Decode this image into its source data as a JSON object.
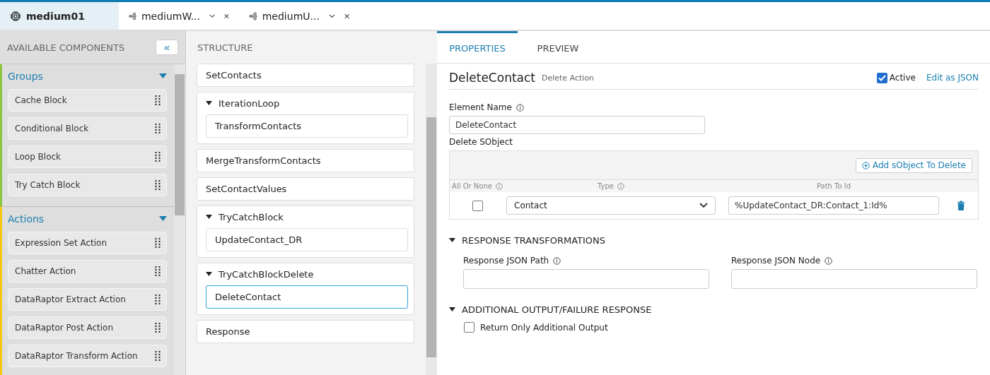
{
  "tabs": [
    {
      "label": "medium01",
      "kind": "chip",
      "selected": true,
      "closable": false
    },
    {
      "label": "mediumW...",
      "kind": "flow",
      "selected": false,
      "closable": true
    },
    {
      "label": "mediumU...",
      "kind": "flow",
      "selected": false,
      "closable": true
    }
  ],
  "components": {
    "title": "AVAILABLE COMPONENTS",
    "collapse": "«",
    "sections": [
      {
        "title": "Groups",
        "color": "#8cc63f",
        "expanded": true,
        "items": [
          "Cache Block",
          "Conditional Block",
          "Loop Block",
          "Try Catch Block"
        ]
      },
      {
        "title": "Actions",
        "color": "#f5c518",
        "expanded": true,
        "items": [
          "Expression Set Action",
          "Chatter Action",
          "DataRaptor Extract Action",
          "DataRaptor Post Action",
          "DataRaptor Transform Action"
        ]
      }
    ]
  },
  "structure": {
    "title": "STRUCTURE",
    "items": [
      {
        "label": "SetContacts",
        "kind": "step",
        "selected": false
      },
      {
        "label": "IterationLoop",
        "kind": "block",
        "expanded": true,
        "children": [
          {
            "label": "TransformContacts",
            "selected": false
          }
        ]
      },
      {
        "label": "MergeTransformContacts",
        "kind": "step",
        "selected": false
      },
      {
        "label": "SetContactValues",
        "kind": "step",
        "selected": false
      },
      {
        "label": "TryCatchBlock",
        "kind": "block",
        "expanded": true,
        "children": [
          {
            "label": "UpdateContact_DR",
            "selected": false
          }
        ]
      },
      {
        "label": "TryCatchBlockDelete",
        "kind": "block",
        "expanded": true,
        "children": [
          {
            "label": "DeleteContact",
            "selected": true
          }
        ]
      },
      {
        "label": "Response",
        "kind": "step",
        "selected": false
      }
    ]
  },
  "properties": {
    "tabs": [
      {
        "label": "PROPERTIES",
        "selected": true
      },
      {
        "label": "PREVIEW",
        "selected": false
      }
    ],
    "element_title": "DeleteContact",
    "element_type": "Delete Action",
    "active": {
      "label": "Active",
      "checked": true
    },
    "edit_json": "Edit as JSON",
    "element_name": {
      "label": "Element Name",
      "value": "DeleteContact"
    },
    "delete_sobject": {
      "label": "Delete SObject",
      "add_button": "Add sObject To Delete",
      "columns": [
        {
          "label": "All Or None",
          "info": true
        },
        {
          "label": "Type",
          "info": true
        },
        {
          "label": "Path To Id",
          "info": false
        }
      ],
      "rows": [
        {
          "all_or_none": false,
          "type": "Contact",
          "path": "%UpdateContact_DR:Contact_1:Id%"
        }
      ]
    },
    "sections": [
      {
        "title": "RESPONSE TRANSFORMATIONS",
        "expanded": true,
        "fields": [
          {
            "label": "Response JSON Path"
          },
          {
            "label": "Response JSON Node"
          }
        ]
      },
      {
        "title": "ADDITIONAL OUTPUT/FAILURE RESPONSE",
        "expanded": true,
        "checkbox": {
          "label": "Return Only Additional Output",
          "checked": false
        }
      }
    ]
  }
}
